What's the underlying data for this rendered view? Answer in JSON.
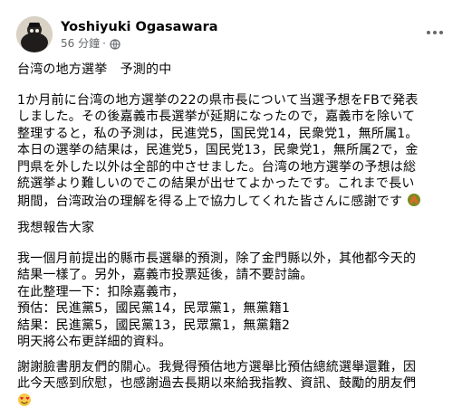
{
  "post": {
    "author_name": "Yoshiyuki Ogasawara",
    "timestamp": "56 分鐘",
    "separator": "·",
    "privacy_icon": "globe-icon",
    "more_icon": "more-options-icon",
    "title": "台湾の地方選挙　予測的中",
    "japanese_paragraph": [
      "1か月前に台湾の地方選挙の22の県市長について当選予想をFBで発表",
      "しました。その後嘉義市長選挙が延期になったので，嘉義市を除いて",
      "整理すると，私の予測は，民進党5，国民党14，民衆党1，無所属1。",
      "本日の選挙の結果は，民進党5，国民党13，民衆党1，無所属2で，金",
      "門県を外した以外は全部的中させました。台湾の地方選挙の予想は総",
      "統選挙より難しいのでこの結果が出せてよかったです。これまで長い",
      "期間，台湾政治の理解を得る上で協力してくれた皆さんに感謝です"
    ],
    "japanese_emoji": "hands-icon",
    "chinese_intro": "我想報告大家",
    "chinese_paragraph": [
      "我一個月前提出的縣市長選舉的預測，除了金門縣以外，其他都今天的",
      "結果一樣了。另外，嘉義市投票延後，請不要討論。",
      "在此整理一下：扣除嘉義市，",
      "預估：民進黨5，國民黨14，民眾黨1，無黨籍1",
      "結果：民進黨5，國民黨13，民眾黨1，無黨籍2",
      "明天將公布更詳細的資料。"
    ],
    "closing_paragraph": [
      "謝謝臉書朋友們的關心。我覺得預估地方選舉比預估總統選舉還難，因",
      "此今天感到欣慰，也感謝過去長期以來給我指教、資訊、鼓勵的朋友們"
    ],
    "closing_emoji": "heart-eyes-emoji-icon"
  }
}
